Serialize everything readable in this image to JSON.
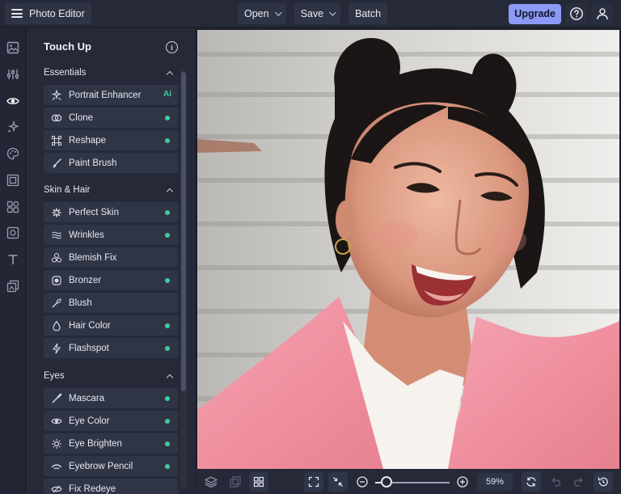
{
  "app": {
    "title": "Photo Editor"
  },
  "topbar": {
    "open_label": "Open",
    "save_label": "Save",
    "batch_label": "Batch",
    "upgrade_label": "Upgrade"
  },
  "rail": {
    "icons": [
      "image-icon",
      "sliders-icon",
      "eye-icon",
      "sparkle-icon",
      "palette-icon",
      "frame-icon",
      "shapes-icon",
      "texture-icon",
      "text-icon",
      "layers-stack-icon"
    ]
  },
  "panel": {
    "title": "Touch Up",
    "sections": [
      {
        "name": "Essentials",
        "items": [
          {
            "label": "Portrait Enhancer",
            "badge": "Ai"
          },
          {
            "label": "Clone"
          },
          {
            "label": "Reshape"
          },
          {
            "label": "Paint Brush"
          }
        ]
      },
      {
        "name": "Skin & Hair",
        "items": [
          {
            "label": "Perfect Skin"
          },
          {
            "label": "Wrinkles"
          },
          {
            "label": "Blemish Fix"
          },
          {
            "label": "Bronzer"
          },
          {
            "label": "Blush"
          },
          {
            "label": "Hair Color"
          },
          {
            "label": "Flashspot"
          }
        ]
      },
      {
        "name": "Eyes",
        "items": [
          {
            "label": "Mascara"
          },
          {
            "label": "Eye Color"
          },
          {
            "label": "Eye Brighten"
          },
          {
            "label": "Eyebrow Pencil"
          },
          {
            "label": "Fix Redeye"
          }
        ]
      }
    ]
  },
  "bottombar": {
    "zoom": {
      "label": "59%",
      "value": 59
    }
  },
  "colors": {
    "accent": "#8c9af5",
    "active_dot": "#3ccf9f",
    "panel_bg": "#262a38",
    "tool_bg": "#303546"
  }
}
